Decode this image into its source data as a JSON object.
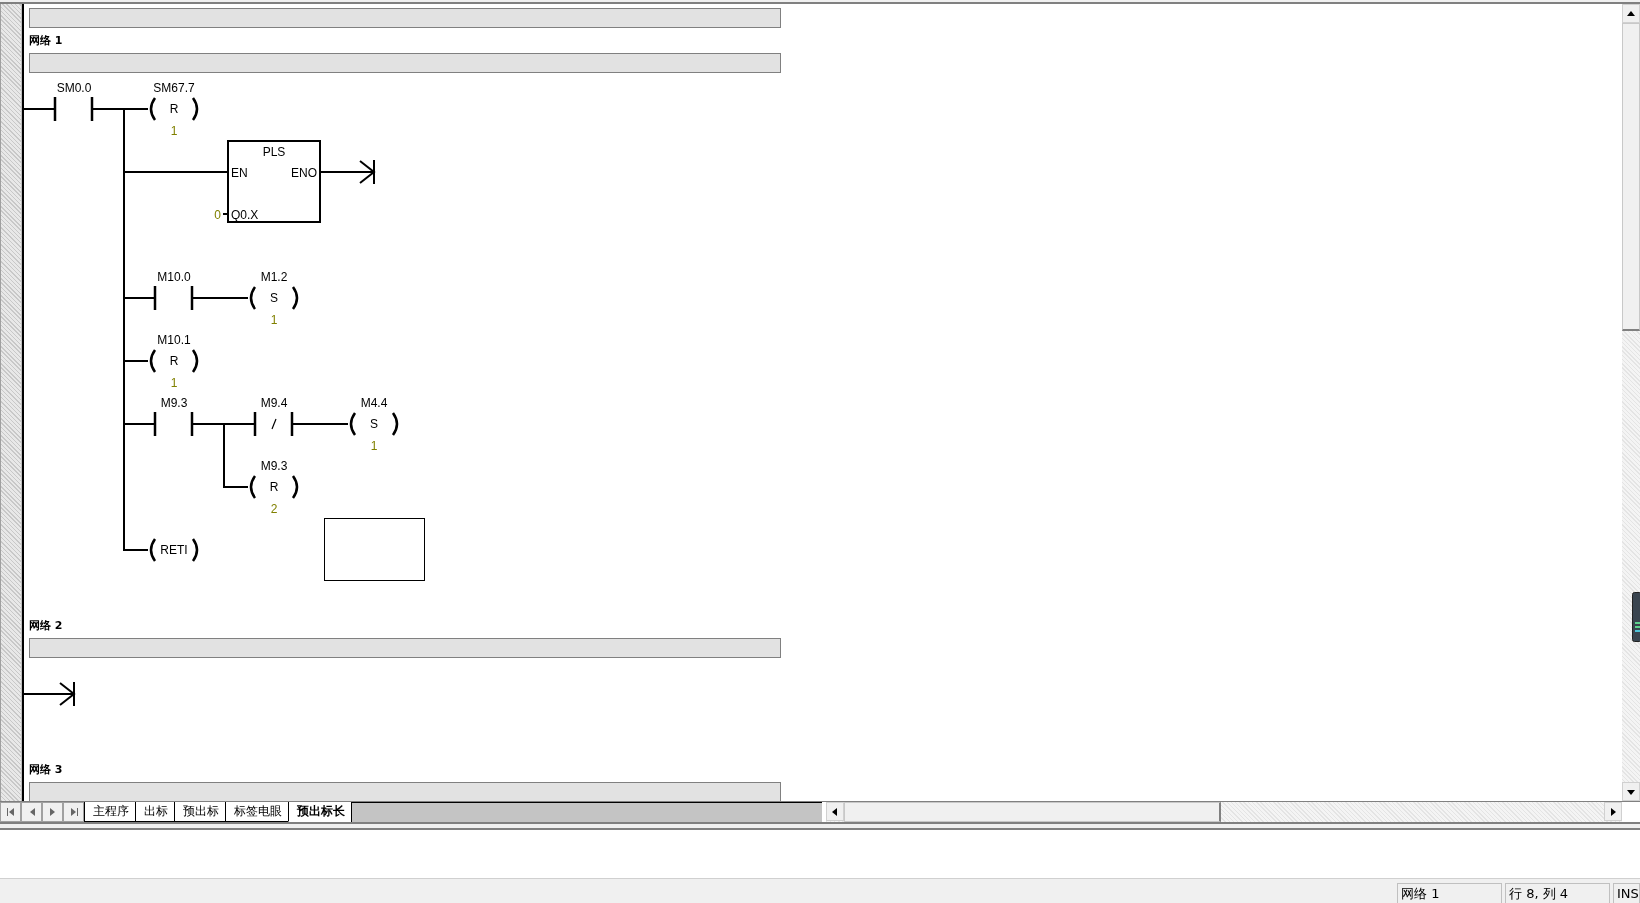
{
  "networks": [
    {
      "title": "网络 1",
      "diagram": [
        {
          "kind": "contact",
          "operand": "SM0.0",
          "negated": false
        },
        {
          "kind": "parallel",
          "branches": [
            [
              {
                "kind": "coil",
                "operand": "SM67.7",
                "instruction": "R",
                "count": "1"
              }
            ],
            [
              {
                "kind": "box",
                "name": "PLS",
                "enable_in": "EN",
                "enable_out": "ENO",
                "inputs": [
                  {
                    "pin": "Q0.X",
                    "value": "0"
                  }
                ]
              },
              {
                "kind": "end"
              }
            ],
            [
              {
                "kind": "contact",
                "operand": "M10.0",
                "negated": false
              },
              {
                "kind": "coil",
                "operand": "M1.2",
                "instruction": "S",
                "count": "1"
              }
            ],
            [
              {
                "kind": "coil",
                "operand": "M10.1",
                "instruction": "R",
                "count": "1"
              }
            ],
            [
              {
                "kind": "contact",
                "operand": "M9.3",
                "negated": false
              },
              {
                "kind": "parallel",
                "branches": [
                  [
                    {
                      "kind": "contact",
                      "operand": "M9.4",
                      "negated": true
                    },
                    {
                      "kind": "coil",
                      "operand": "M4.4",
                      "instruction": "S",
                      "count": "1"
                    }
                  ],
                  [
                    {
                      "kind": "coil",
                      "operand": "M9.3",
                      "instruction": "R",
                      "count": "2"
                    }
                  ]
                ]
              }
            ],
            [
              {
                "kind": "coil",
                "instruction": "RETI"
              },
              {
                "kind": "blank",
                "selected": false
              },
              {
                "kind": "blank",
                "selected": true
              }
            ]
          ]
        }
      ]
    },
    {
      "title": "网络 2",
      "diagram": [
        {
          "kind": "end"
        }
      ]
    },
    {
      "title": "网络 3"
    }
  ],
  "tabs": [
    {
      "label": "主程序",
      "selected": false
    },
    {
      "label": "出标",
      "selected": false
    },
    {
      "label": "预出标",
      "selected": false
    },
    {
      "label": "标签电眼",
      "selected": false
    },
    {
      "label": "预出标长",
      "selected": true
    }
  ],
  "status_bar": {
    "network": "网络 1",
    "position": "行 8, 列 4",
    "mode": "INS"
  }
}
